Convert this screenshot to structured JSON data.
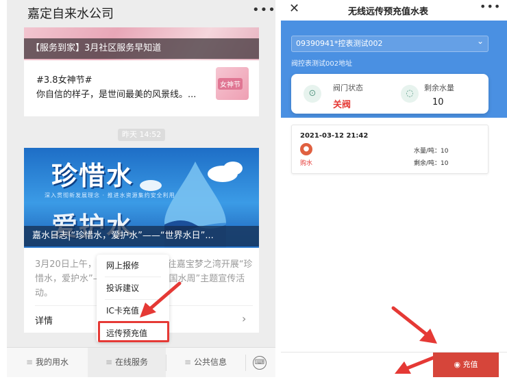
{
  "left": {
    "title": "嘉定自来水公司",
    "menu_icon": "ellipsis-icon",
    "card1": {
      "caption": "【服务到家】3月社区服务早知道",
      "tag": "#3.8女神节#",
      "text": "你自信的样子，是世间最美的风景线。...",
      "thumb_label": "女神节"
    },
    "timestamp": "昨天 14:52",
    "card2": {
      "headline_1": "珍惜水",
      "subline": "深入贯彻新发展理念 · 推进水资源集约安全利用",
      "headline_2": "爱护水",
      "caption": "嘉水日志|“珍惜水，爱护水”——“世界水日”...",
      "excerpt": "3月20日上午，嘉定自来水公司前往嘉宝梦之湾开展“珍惜水，爱护水”——“世界水日、中国水周”主题宣传活动。",
      "detail": "详情",
      "chevron": "›"
    },
    "nav": {
      "tab1": "我的用水",
      "tab2": "在线服务",
      "tab3": "公共信息",
      "keyboard_icon": "keyboard-icon"
    },
    "popup": {
      "item1": "网上报修",
      "item2": "投诉建议",
      "item3": "IC卡充值",
      "item4": "远传预充值"
    }
  },
  "right": {
    "title": "无线远传预充值水表",
    "close": "✕",
    "meter_select": "09390941*控表测试002",
    "meter_address": "阀控表测试002地址",
    "valve_label": "阀门状态",
    "valve_value": "关阀",
    "water_label": "剩余水量",
    "water_value": "10",
    "record": {
      "time": "2021-03-12 21:42",
      "type": "购水",
      "line1": "水量/吨：10",
      "line2": "剩余/吨：10"
    },
    "recharge_button": "充值"
  },
  "colors": {
    "accent_blue": "#4a90e2",
    "alert_red": "#e53935",
    "recharge_red": "#d6453a"
  }
}
